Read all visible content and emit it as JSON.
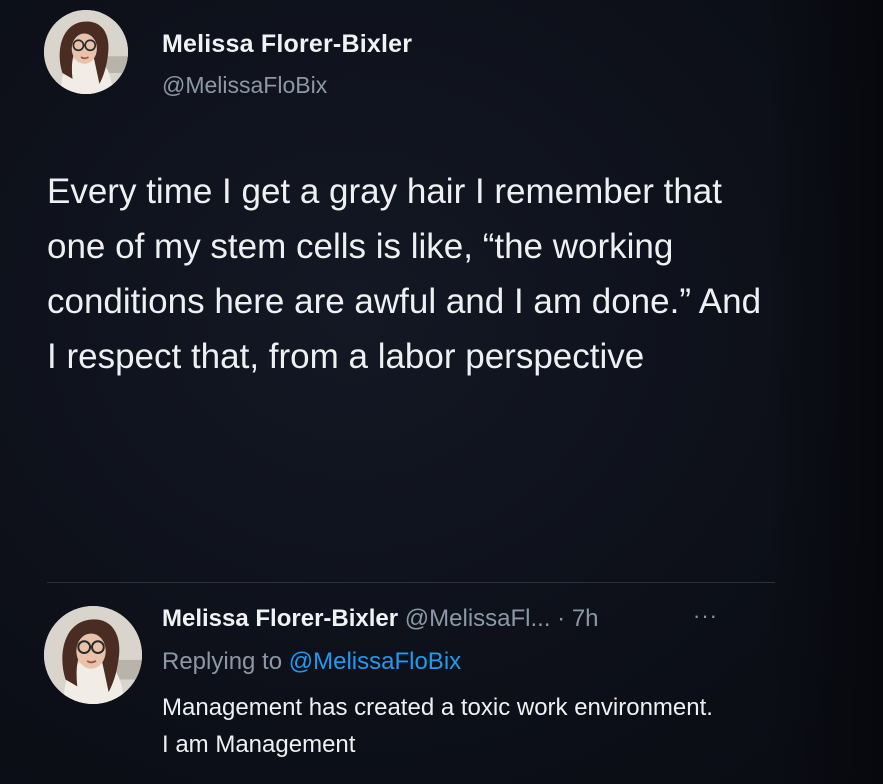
{
  "tweet": {
    "author_name": "Melissa Florer-Bixler",
    "author_handle": "@MelissaFloBix",
    "text": "Every time I get a gray hair I remember that one of my stem cells is like, “the working conditions here are awful and I am done.” And I respect that, from a labor perspective"
  },
  "reply": {
    "author_name": "Melissa Florer-Bixler",
    "author_handle": "@MelissaFl...",
    "time": "· 7h",
    "more_icon": "···",
    "replying_to_label": "Replying to",
    "replying_to_handle": "@MelissaFloBix",
    "text": "Management has created a toxic work environment. I am Management"
  },
  "colors": {
    "background": "#0c0f17",
    "text_primary": "#e7e9ea",
    "text_secondary": "#8b98a5",
    "link": "#1d9bf0"
  }
}
